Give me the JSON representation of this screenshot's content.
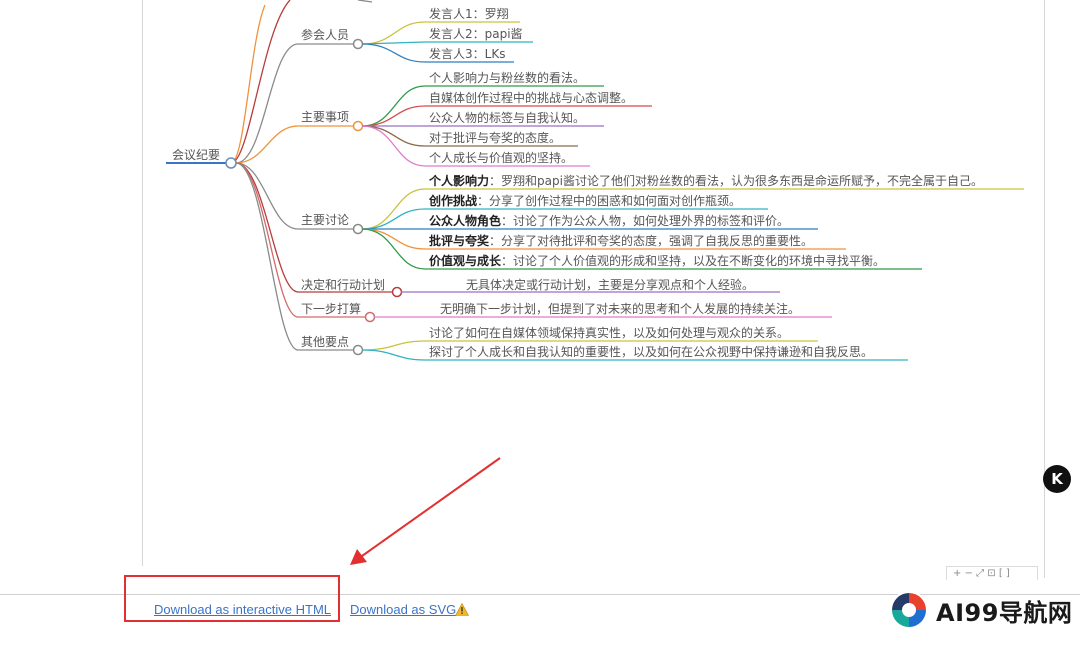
{
  "root": {
    "label": "会议纪要"
  },
  "branches": [
    {
      "label": "参会人员",
      "items": [
        {
          "text": "发言人1：罗翔"
        },
        {
          "text": "发言人2：papi酱"
        },
        {
          "text": "发言人3：LKs"
        }
      ]
    },
    {
      "label": "主要事项",
      "items": [
        {
          "text": "个人影响力与粉丝数的看法。"
        },
        {
          "text": "自媒体创作过程中的挑战与心态调整。"
        },
        {
          "text": "公众人物的标签与自我认知。"
        },
        {
          "text": "对于批评与夸奖的态度。"
        },
        {
          "text": "个人成长与价值观的坚持。"
        }
      ]
    },
    {
      "label": "主要讨论",
      "items": [
        {
          "bold": "个人影响力",
          "text": "：罗翔和papi酱讨论了他们对粉丝数的看法，认为很多东西是命运所赋予，不完全属于自己。"
        },
        {
          "bold": "创作挑战",
          "text": "：分享了创作过程中的困惑和如何面对创作瓶颈。"
        },
        {
          "bold": "公众人物角色",
          "text": "：讨论了作为公众人物，如何处理外界的标签和评价。"
        },
        {
          "bold": "批评与夸奖",
          "text": "：分享了对待批评和夸奖的态度，强调了自我反思的重要性。"
        },
        {
          "bold": "价值观与成长",
          "text": "：讨论了个人价值观的形成和坚持，以及在不断变化的环境中寻找平衡。"
        }
      ]
    },
    {
      "label": "决定和行动计划",
      "items": [
        {
          "text": "无具体决定或行动计划，主要是分享观点和个人经验。"
        }
      ]
    },
    {
      "label": "下一步打算",
      "items": [
        {
          "text": "无明确下一步计划，但提到了对未来的思考和个人发展的持续关注。"
        }
      ]
    },
    {
      "label": "其他要点",
      "items": [
        {
          "text": "讨论了如何在自媒体领域保持真实性，以及如何处理与观众的关系。"
        },
        {
          "text": "探讨了个人成长和自我认知的重要性，以及如何在公众视野中保持谦逊和自我反思。"
        }
      ]
    }
  ],
  "footer": {
    "download_html": "Download as interactive HTML",
    "download_svg": "Download as SVG"
  },
  "toolbar": {
    "text": "+ − ⤢ ⊡ [ ]"
  },
  "floating_icon": {
    "text": "K"
  },
  "brand": {
    "name": "AI99导航网"
  },
  "colors": {
    "annotation_red": "#e23030",
    "link_blue": "#3b73c8",
    "branch_colors": [
      "#8a8a8a",
      "#f0923b",
      "#8a8a8a",
      "#b93c3c",
      "#d36a6a",
      "#8a8a8a"
    ]
  }
}
